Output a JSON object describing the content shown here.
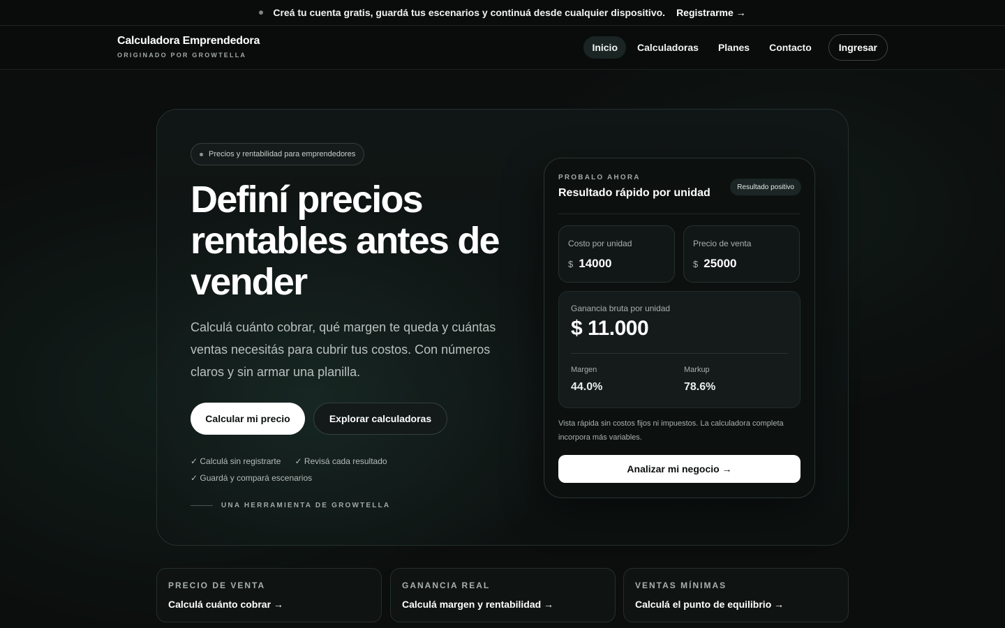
{
  "announcement": {
    "text": "Creá tu cuenta gratis, guardá tus escenarios y continuá desde cualquier dispositivo.",
    "link": "Registrarme →"
  },
  "header": {
    "brand_name": "Calculadora Emprendedora",
    "brand_sub": "ORIGINADO POR GROWTELLA",
    "nav": [
      {
        "label": "Inicio",
        "active": true
      },
      {
        "label": "Calculadoras",
        "active": false
      },
      {
        "label": "Planes",
        "active": false
      },
      {
        "label": "Contacto",
        "active": false
      }
    ],
    "login_label": "Ingresar"
  },
  "hero": {
    "pill": "Precios y rentabilidad para emprendedores",
    "title": "Definí precios rentables antes de vender",
    "description": "Calculá cuánto cobrar, qué margen te queda y cuántas ventas necesitás para cubrir tus costos. Con números claros y sin armar una planilla.",
    "primary_button": "Calcular mi precio",
    "secondary_button": "Explorar calculadoras",
    "checks": [
      "✓ Calculá sin registrarte",
      "✓ Revisá cada resultado",
      "✓ Guardá y compará escenarios"
    ],
    "tagline": "UNA HERRAMIENTA DE GROWTELLA"
  },
  "quick_card": {
    "eyebrow": "PROBALO AHORA",
    "title": "Resultado rápido por unidad",
    "badge": "Resultado positivo",
    "cost": {
      "label": "Costo por unidad",
      "currency": "$",
      "value": "14000"
    },
    "price": {
      "label": "Precio de venta",
      "currency": "$",
      "value": "25000"
    },
    "result": {
      "label": "Ganancia bruta por unidad",
      "value": "$ 11.000",
      "margin_label": "Margen",
      "margin_value": "44.0%",
      "markup_label": "Markup",
      "markup_value": "78.6%"
    },
    "note": "Vista rápida sin costos fijos ni impuestos. La calculadora completa incorpora más variables.",
    "button": "Analizar mi negocio →"
  },
  "tiles": [
    {
      "eyebrow": "PRECIO DE VENTA",
      "title": "Calculá cuánto cobrar →"
    },
    {
      "eyebrow": "GANANCIA REAL",
      "title": "Calculá margen y rentabilidad →"
    },
    {
      "eyebrow": "VENTAS MÍNIMAS",
      "title": "Calculá el punto de equilibrio →"
    }
  ],
  "colors": {
    "background": "#0b0e0d",
    "accent_surface": "#1a2523",
    "text_primary": "#ffffff",
    "text_muted": "#a9b1ae"
  }
}
